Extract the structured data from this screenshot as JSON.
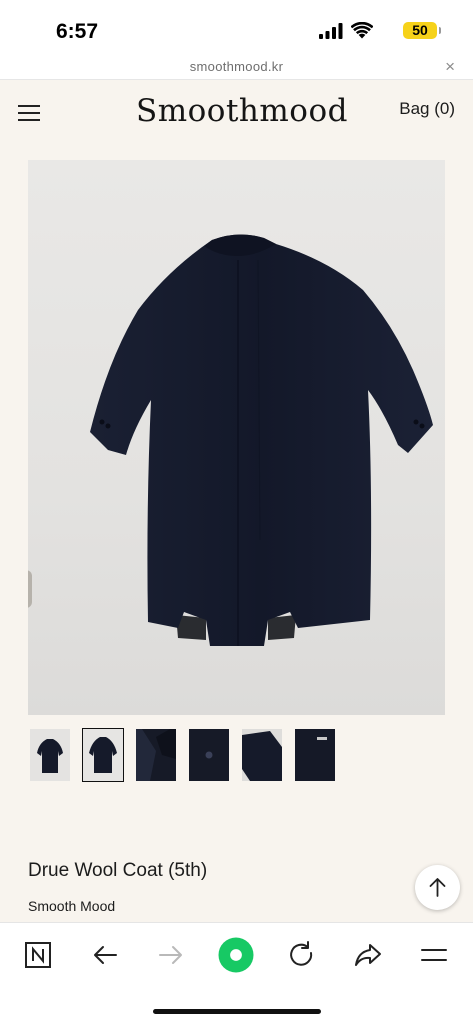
{
  "status_bar": {
    "time": "6:57",
    "battery_level": "50",
    "icons": [
      "signal-icon",
      "wifi-icon",
      "battery-icon"
    ],
    "battery_color": "#f6d21a"
  },
  "browser": {
    "url": "smoothmood.kr",
    "close_symbol": "×",
    "toolbar_icons": [
      "naver-n-icon",
      "back-arrow-icon",
      "forward-arrow-icon",
      "green-dot-icon",
      "reload-icon",
      "share-icon",
      "menu-icon"
    ],
    "accent_color": "#17c964"
  },
  "header": {
    "logo": "Smoothmood",
    "bag_label": "Bag (0)",
    "menu_icon": "hamburger-menu-icon"
  },
  "product": {
    "title": "Drue Wool Coat (5th)",
    "brand": "Smooth Mood",
    "thumbnail_count": 6,
    "active_thumbnail": 2
  },
  "colors": {
    "page_background": "#f8f4ee",
    "coat_navy": "#161b2c"
  }
}
